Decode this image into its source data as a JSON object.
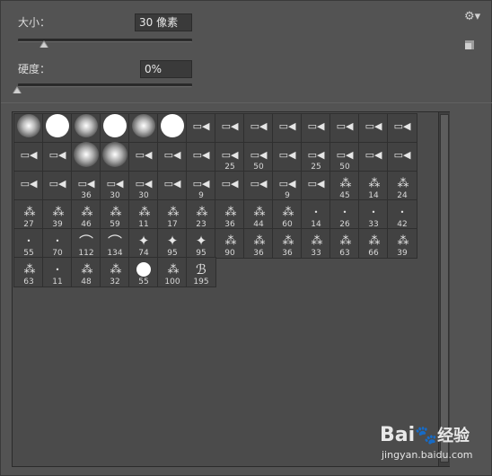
{
  "size": {
    "label": "大小：",
    "value": "30 像素",
    "slider_fraction": 0.15
  },
  "hardness": {
    "label": "硬度：",
    "value": "0%",
    "slider_fraction": 0.0
  },
  "icons": {
    "settings": "gear-icon",
    "new_preset": "new-preset-icon"
  },
  "brushes": {
    "rows": [
      [
        {
          "type": "soft",
          "size": ""
        },
        {
          "type": "hard",
          "size": ""
        },
        {
          "type": "soft",
          "size": ""
        },
        {
          "type": "hard",
          "size": ""
        },
        {
          "type": "soft",
          "size": ""
        },
        {
          "type": "hard",
          "size": ""
        },
        {
          "type": "tool",
          "size": ""
        },
        {
          "type": "tool",
          "size": ""
        },
        {
          "type": "tool",
          "size": ""
        },
        {
          "type": "tool",
          "size": ""
        },
        {
          "type": "tool",
          "size": ""
        },
        {
          "type": "tool",
          "size": ""
        },
        {
          "type": "tool",
          "size": ""
        },
        {
          "type": "tool",
          "size": ""
        }
      ],
      [
        {
          "type": "tool",
          "size": ""
        },
        {
          "type": "tool",
          "size": ""
        },
        {
          "type": "softbig",
          "size": ""
        },
        {
          "type": "softbig",
          "size": ""
        },
        {
          "type": "tool",
          "size": ""
        },
        {
          "type": "tool",
          "size": ""
        },
        {
          "type": "tool",
          "size": ""
        },
        {
          "type": "tool",
          "size": "25"
        },
        {
          "type": "tool",
          "size": "50"
        },
        {
          "type": "tool",
          "size": ""
        },
        {
          "type": "tool",
          "size": "25"
        },
        {
          "type": "tool",
          "size": "50"
        },
        {
          "type": "tool",
          "size": ""
        },
        {
          "type": "tool",
          "size": ""
        }
      ],
      [
        {
          "type": "tool",
          "size": ""
        },
        {
          "type": "tool",
          "size": ""
        },
        {
          "type": "tool",
          "size": "36"
        },
        {
          "type": "tool",
          "size": "30"
        },
        {
          "type": "tool",
          "size": "30"
        },
        {
          "type": "tool",
          "size": ""
        },
        {
          "type": "tool",
          "size": "9"
        },
        {
          "type": "tool",
          "size": ""
        },
        {
          "type": "tool",
          "size": ""
        },
        {
          "type": "tool",
          "size": "9"
        },
        {
          "type": "tool",
          "size": ""
        },
        {
          "type": "splat",
          "size": "45"
        },
        {
          "type": "splat",
          "size": "14"
        },
        {
          "type": "splat",
          "size": "24"
        }
      ],
      [
        {
          "type": "splat",
          "size": "27"
        },
        {
          "type": "splat",
          "size": "39"
        },
        {
          "type": "splat",
          "size": "46"
        },
        {
          "type": "splat",
          "size": "59"
        },
        {
          "type": "splat",
          "size": "11"
        },
        {
          "type": "splat",
          "size": "17"
        },
        {
          "type": "splat",
          "size": "23"
        },
        {
          "type": "splat",
          "size": "36"
        },
        {
          "type": "splat",
          "size": "44"
        },
        {
          "type": "splat",
          "size": "60"
        },
        {
          "type": "dot",
          "size": "14"
        },
        {
          "type": "dot",
          "size": "26"
        },
        {
          "type": "dot",
          "size": "33"
        },
        {
          "type": "dot",
          "size": "42"
        }
      ],
      [
        {
          "type": "dot",
          "size": "55"
        },
        {
          "type": "dot",
          "size": "70"
        },
        {
          "type": "grass",
          "size": "112"
        },
        {
          "type": "grass",
          "size": "134"
        },
        {
          "type": "leaf",
          "size": "74"
        },
        {
          "type": "leaf",
          "size": "95"
        },
        {
          "type": "leaf",
          "size": "95"
        },
        {
          "type": "splat",
          "size": "90"
        },
        {
          "type": "splat",
          "size": "36"
        },
        {
          "type": "splat",
          "size": "36"
        },
        {
          "type": "splat",
          "size": "33"
        },
        {
          "type": "splat",
          "size": "63"
        },
        {
          "type": "splat",
          "size": "66"
        },
        {
          "type": "splat",
          "size": "39"
        }
      ],
      [
        {
          "type": "splat",
          "size": "63"
        },
        {
          "type": "dot",
          "size": "11"
        },
        {
          "type": "splat",
          "size": "48"
        },
        {
          "type": "splat",
          "size": "32"
        },
        {
          "type": "hardsmall",
          "size": "55"
        },
        {
          "type": "splat",
          "size": "100"
        },
        {
          "type": "butterfly",
          "size": "195"
        }
      ]
    ]
  },
  "watermark": {
    "logo_text": "Bai",
    "logo_paw": "🐾",
    "logo_suffix": "经验",
    "url": "jingyan.baidu.com"
  }
}
